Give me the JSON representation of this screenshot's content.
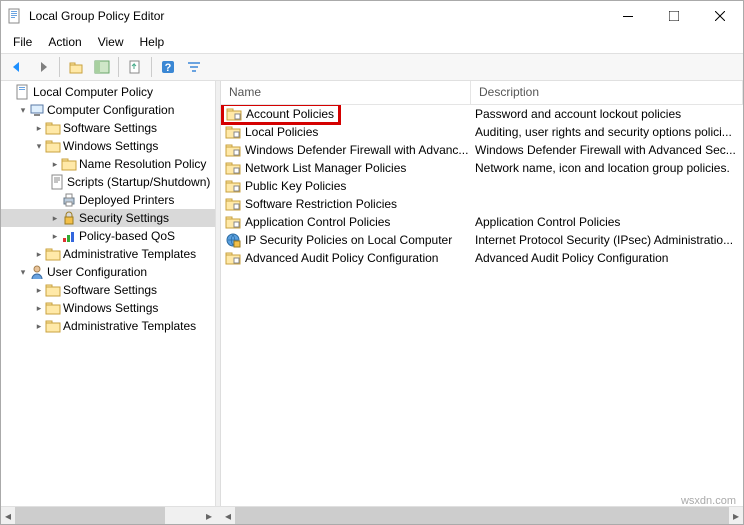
{
  "window": {
    "title": "Local Group Policy Editor"
  },
  "menubar": [
    "File",
    "Action",
    "View",
    "Help"
  ],
  "tree": {
    "root": "Local Computer Policy",
    "computer_cfg": "Computer Configuration",
    "cc_software": "Software Settings",
    "cc_windows": "Windows Settings",
    "cc_win_nrp": "Name Resolution Policy",
    "cc_win_scripts": "Scripts (Startup/Shutdown)",
    "cc_win_printers": "Deployed Printers",
    "cc_win_sec": "Security Settings",
    "cc_win_qos": "Policy-based QoS",
    "cc_admin": "Administrative Templates",
    "user_cfg": "User Configuration",
    "uc_software": "Software Settings",
    "uc_windows": "Windows Settings",
    "uc_admin": "Administrative Templates"
  },
  "list": {
    "header_name": "Name",
    "header_desc": "Description",
    "rows": [
      {
        "name": "Account Policies",
        "desc": "Password and account lockout policies",
        "icon": "folder",
        "highlight": true
      },
      {
        "name": "Local Policies",
        "desc": "Auditing, user rights and security options polici...",
        "icon": "folder"
      },
      {
        "name": "Windows Defender Firewall with Advanc...",
        "desc": "Windows Defender Firewall with Advanced Sec...",
        "icon": "folder"
      },
      {
        "name": "Network List Manager Policies",
        "desc": "Network name, icon and location group policies.",
        "icon": "folder"
      },
      {
        "name": "Public Key Policies",
        "desc": "",
        "icon": "folder"
      },
      {
        "name": "Software Restriction Policies",
        "desc": "",
        "icon": "folder"
      },
      {
        "name": "Application Control Policies",
        "desc": "Application Control Policies",
        "icon": "folder"
      },
      {
        "name": "IP Security Policies on Local Computer",
        "desc": "Internet Protocol Security (IPsec) Administratio...",
        "icon": "ipsec"
      },
      {
        "name": "Advanced Audit Policy Configuration",
        "desc": "Advanced Audit Policy Configuration",
        "icon": "folder"
      }
    ]
  },
  "watermark": "wsxdn.com"
}
